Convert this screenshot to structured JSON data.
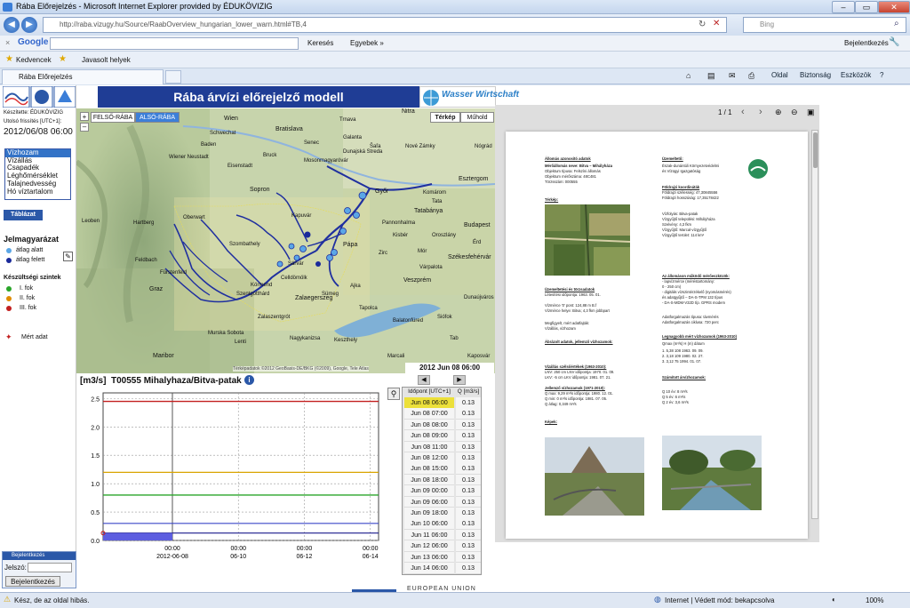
{
  "browser": {
    "window_title": "Rába Előrejelzés - Microsoft Internet Explorer provided by ÉDUKÖVIZIG",
    "address": "http://raba.vizugy.hu/Source/RaabOverview_hungarian_lower_warn.html#TB,4",
    "search_placeholder": "Bing",
    "google_label": "Google",
    "google_search_label": "Keresés",
    "google_more_label": "Egyebek »",
    "google_signin_label": "Bejelentkezés",
    "favorites_label": "Kedvencek",
    "suggested_sites_label": "Javasolt helyek",
    "tab_title": "Rába Előrejelzés",
    "cmd_page": "Oldal",
    "cmd_safety": "Biztonság",
    "cmd_tools": "Eszközök",
    "status_text": "Kész, de az oldal hibás.",
    "status_zone": "Internet | Védett mód: bekapcsolva",
    "zoom": "100%"
  },
  "left_panel": {
    "made_by": "Készítette: ÉDUKÖVIZIG",
    "last_update_label": "Utolsó frissítés [UTC+1]:",
    "last_update": "2012/06/08 06:00",
    "params": [
      "Vízhozam",
      "Vízállás",
      "Csapadék",
      "Léghőmérséklet",
      "Talajnedvesség",
      "Hó víztartalom"
    ],
    "table_button": "Táblázat",
    "legend_title": "Jelmagyarázat",
    "legend_below": "átlag alatt",
    "legend_above": "átlag felett",
    "levels_title": "Készültségi szintek",
    "level1": "I. fok",
    "level2": "II. fok",
    "level3": "III. fok",
    "measured": "Mért adat",
    "login_header": "Bejelentkezés",
    "password_label": "Jelszó:",
    "login_button": "Bejelentkezés"
  },
  "header": {
    "title": "Rába árvízi előrejelző modell",
    "partner_logo": "Wasser Wirtschaft"
  },
  "map": {
    "tab_upper": "FELSŐ-RÁBA",
    "tab_lower": "ALSÓ-RÁBA",
    "view_map": "Térkép",
    "view_satellite": "Műhold",
    "timestamp": "2012 Jun 08 06:00",
    "copyright": "Térképadatok ©2012 GeoBasis-DE/BKG (©2009), Google, Tele Atlas",
    "cities": [
      "Wien",
      "Bratislava",
      "Nitra",
      "Schwechat",
      "Győr",
      "Tatabánya",
      "Budapest",
      "Szombathely",
      "Sopron",
      "Pápa",
      "Veszprém",
      "Zalaegerszeg",
      "Graz",
      "Maribor",
      "Székesfehérvár",
      "Komárom",
      "Esztergom",
      "Kapuvár",
      "Sárvár",
      "Sümeg",
      "Tapolca",
      "Ajka",
      "Balatonfüred",
      "Siófok",
      "Nagykanizsa",
      "Keszthely",
      "Wiener Neustadt",
      "Mosonmagyaróvár",
      "Dunajská Streda",
      "Nové Zámky",
      "Šaľa",
      "Zirc",
      "Oroszlány",
      "Mór",
      "Körmend",
      "Oberwart",
      "Hartberg",
      "Feldbach",
      "Murska Sobota",
      "Marcali",
      "Kaposvár",
      "Galanta",
      "Senec",
      "Trnava",
      "Baden",
      "Eisenstadt",
      "Dunaújváros",
      "Zalaszentgrót",
      "Tata",
      "Érd",
      "Bruck",
      "Pannonhalma",
      "Celldömölk",
      "Szentgotthárd",
      "Nógrád",
      "Leoben",
      "Fürstenfeld",
      "Várpalota",
      "Lenti",
      "Tab",
      "Kisbér"
    ]
  },
  "chart": {
    "unit": "[m3/s]",
    "station": "T00555 Mihalyhaza/Bitva-patak"
  },
  "chart_data": {
    "type": "line",
    "title": "T00555 Mihalyhaza/Bitva-patak",
    "ylabel": "[m3/s]",
    "ylim": [
      0,
      2.6
    ],
    "yticks": [
      "0.0",
      "0.5",
      "1.0",
      "1.5",
      "2.0",
      "2.5"
    ],
    "xticks": [
      {
        "time": "00:00",
        "date": "2012-06-08"
      },
      {
        "time": "00:00",
        "date": "06-10"
      },
      {
        "time": "00:00",
        "date": "06-12"
      },
      {
        "time": "00:00",
        "date": "06-14"
      }
    ],
    "thresholds": [
      {
        "level": "I. fok",
        "value": 0.8,
        "color": "#2aa52a"
      },
      {
        "level": "II. fok",
        "value": 1.2,
        "color": "#d9a400"
      },
      {
        "level": "III. fok",
        "value": 2.45,
        "color": "#c21f1f"
      }
    ],
    "reference_lines": [
      {
        "value": 0.3,
        "color": "#3b48c8"
      },
      {
        "value": 0.13,
        "color": "#1a1a8c"
      }
    ],
    "series": [
      {
        "x_days_from": "2012-06-07 18:00",
        "values": [
          0.13,
          0.13,
          0.13,
          0.13,
          0.13
        ],
        "color": "#5d5ee0"
      }
    ],
    "grid": true
  },
  "table": {
    "col_time": "Időpont [UTC+1]",
    "col_q": "Q [m3/s]",
    "rows": [
      {
        "t": "Jun 08 06:00",
        "q": "0.13"
      },
      {
        "t": "Jun 08 07:00",
        "q": "0.13"
      },
      {
        "t": "Jun 08 08:00",
        "q": "0.13"
      },
      {
        "t": "Jun 08 09:00",
        "q": "0.13"
      },
      {
        "t": "Jun 08 11:00",
        "q": "0.13"
      },
      {
        "t": "Jun 08 12:00",
        "q": "0.13"
      },
      {
        "t": "Jun 08 15:00",
        "q": "0.13"
      },
      {
        "t": "Jun 08 18:00",
        "q": "0.13"
      },
      {
        "t": "Jun 09 00:00",
        "q": "0.13"
      },
      {
        "t": "Jun 09 06:00",
        "q": "0.13"
      },
      {
        "t": "Jun 09 18:00",
        "q": "0.13"
      },
      {
        "t": "Jun 10 06:00",
        "q": "0.13"
      },
      {
        "t": "Jun 11 06:00",
        "q": "0.13"
      },
      {
        "t": "Jun 12 06:00",
        "q": "0.13"
      },
      {
        "t": "Jun 13 06:00",
        "q": "0.13"
      },
      {
        "t": "Jun 14 06:00",
        "q": "0.13"
      }
    ]
  },
  "pdf": {
    "page_indicator": "1 / 1",
    "col1_title": "Állomás azonosító adatok",
    "station_name": "Mérőállomás neve: Bitva – Mihályháza",
    "object_type": "Objektum típusa: Felszíni állomás",
    "object_code": "Objektum mérőszáma: 48C481",
    "station_number": "Törzsszám: 000555",
    "map_label": "Térkép:",
    "ops_title": "Üzemeltetési és törzsadatok",
    "ops1": "Létesítési időpontja: 1963. 05. 01.",
    "ops2": "Vízmérce '0' pont: 124,88 m B.f",
    "ops3": "Vízmérce helye: Bitva; 4,3 fkm jobbpart",
    "ops4": "Megfigyelt, mért adatfajták:",
    "ops5": "Vízállás, vízhozam",
    "char_title": "Ábrázolt adatok, jellemző vízhozamok:",
    "char1": "Vízállás szélsőértékek (1963-2010):",
    "char2": "LNV: 250 cm   LNV időpontja: 1970. 01. 09.",
    "char3": "LKV:   -5 cm   LKV időpontja: 1981. 07. 21.",
    "char4": "Jellemző vízhozamok (1971-2010):",
    "char5": "Q max: 9,29 m³/s  időpontja: 1980. 12. 01.",
    "char6": "Q min:    0 m³/s  időpontja: 1981. 07. 05.",
    "char7": "Q átlag: 0,349 m³/s",
    "photos_label": "Képek:",
    "operator_title": "Üzemeltető:",
    "operator1": "Észak-dunántúli Környezetvédelmi",
    "operator2": "és Vízügyi Igazgatóság",
    "geo_title": "Földrajzi koordináták",
    "geo1": "Földrajzi szélesség: 47,30845556",
    "geo2": "Földrajzi hosszúság: 17,35178422",
    "wb1": "Vízfolyás:               Bitva-patak",
    "wb2": "Vízgyűjtő települési:   Mihályháza",
    "wb3": "Szelvény:                 4,3 fkm",
    "wb4": "Vízgyűjtő:               Marcal-vízgyűjtő",
    "wb5": "Vízgyűjtő terület:      114 km²",
    "dev_title": "Az állomáson működő mérőeszközök:",
    "dev1": "- lapvízmérce (méréstartomány:",
    "dev2": "  0 - 250 cm)",
    "dev3": "- digitális vízszintérzékelő (nyomásmérés)",
    "dev4": "  és adatgyűjtő – DA-S-TPM 132 típus",
    "dev5": "- DA-S-MDM-V32D típ. GPRS modem",
    "dev6": "Adatforgalmazás típusa:      távmérés",
    "dev7": "Adatforgalmazás ciklusa:     720 perc",
    "flood_title": "Legnagyobb mért vízhozamok (1963-2010)",
    "flood_head": "        Qmax (m³/s)     H (m)      dátum",
    "flood1": "1.       5,38          108     1963. 09. 09.",
    "flood2": "2.       3,18          109     1980. 02. 27.",
    "flood3": "3.       3,12           75     1994. 01. 07.",
    "calc_title": "Számított árvízhozamok:",
    "calc1": "Q 10 év:    8 m³/s",
    "calc2": "Q 5 év:      6 m³/s",
    "calc3": "Q 2 év:     3,6 m³/s"
  }
}
